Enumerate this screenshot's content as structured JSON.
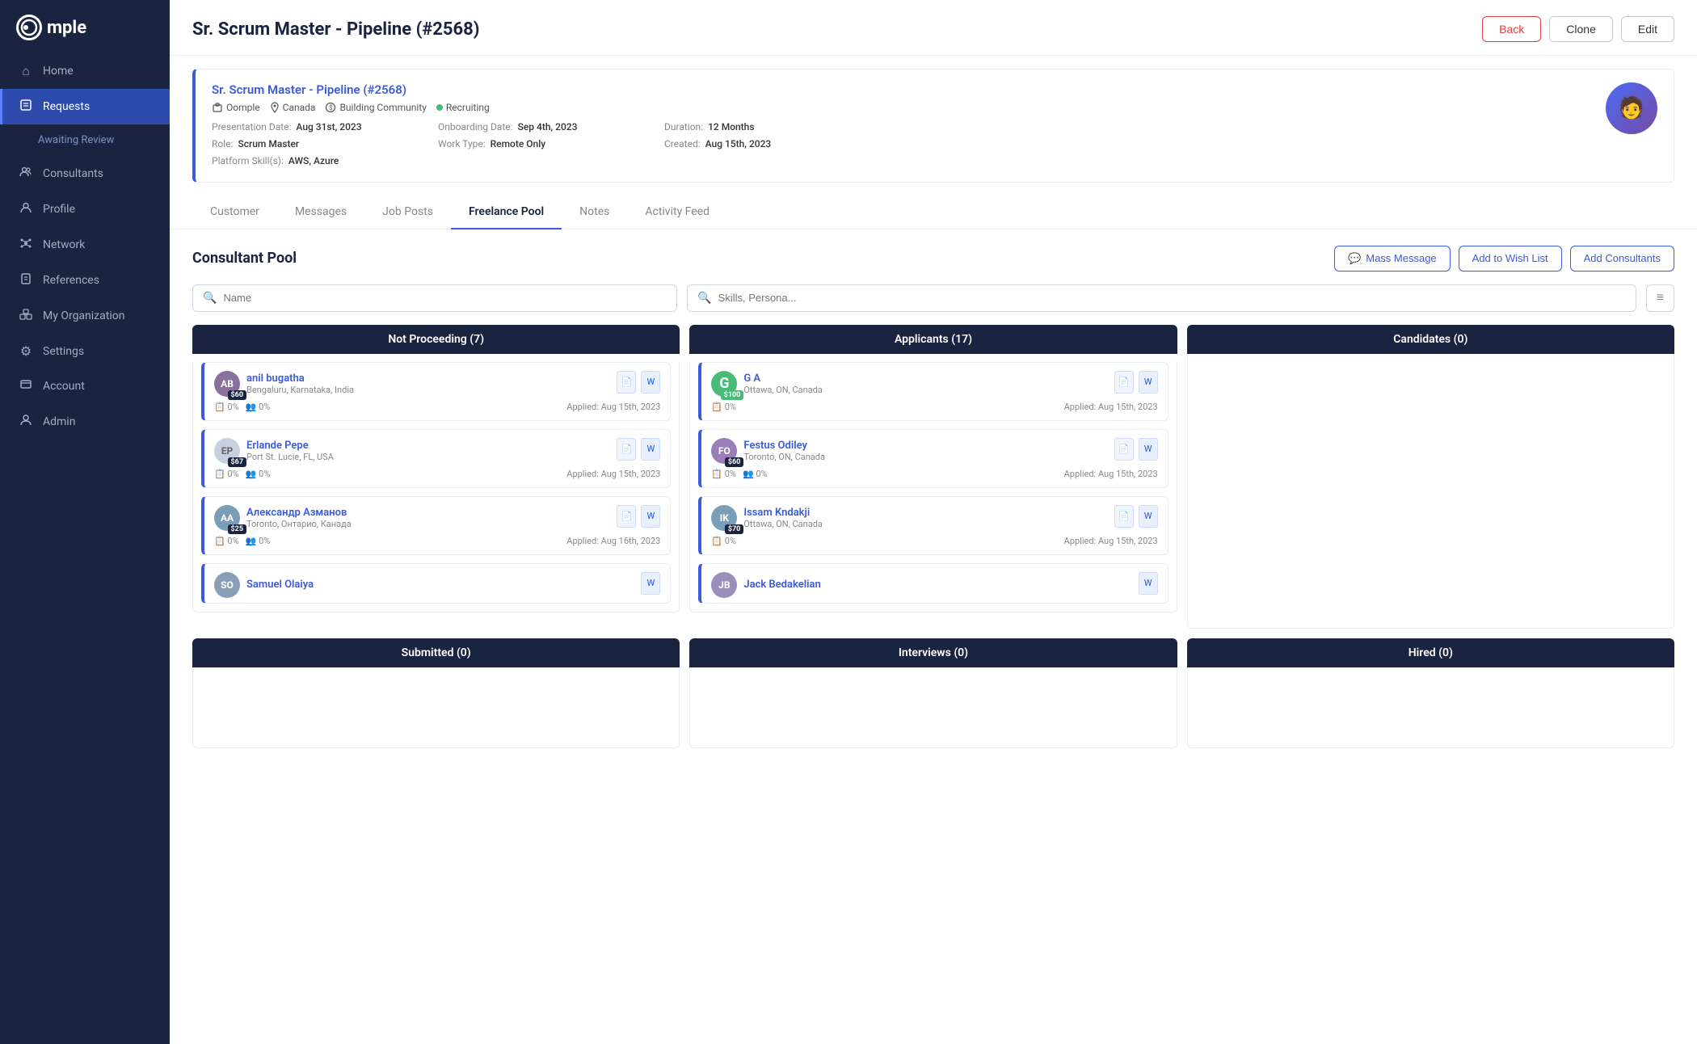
{
  "app": {
    "logo_text": "mple",
    "logo_symbol": "Ω"
  },
  "sidebar": {
    "items": [
      {
        "id": "home",
        "label": "Home",
        "icon": "⌂",
        "active": false
      },
      {
        "id": "requests",
        "label": "Requests",
        "icon": "📋",
        "active": true
      },
      {
        "id": "awaiting-review",
        "label": "Awaiting Review",
        "icon": "",
        "active": false,
        "sub": true
      },
      {
        "id": "consultants",
        "label": "Consultants",
        "icon": "👥",
        "active": false
      },
      {
        "id": "profile",
        "label": "Profile",
        "icon": "👤",
        "active": false
      },
      {
        "id": "network",
        "label": "Network",
        "icon": "🔗",
        "active": false
      },
      {
        "id": "references",
        "label": "References",
        "icon": "📊",
        "active": false
      },
      {
        "id": "my-organization",
        "label": "My Organization",
        "icon": "🏢",
        "active": false
      },
      {
        "id": "settings",
        "label": "Settings",
        "icon": "⚙",
        "active": false
      },
      {
        "id": "account",
        "label": "Account",
        "icon": "🔒",
        "active": false
      },
      {
        "id": "admin",
        "label": "Admin",
        "icon": "👑",
        "active": false
      }
    ]
  },
  "page": {
    "title": "Sr. Scrum Master - Pipeline (#2568)",
    "back_label": "Back",
    "clone_label": "Clone",
    "edit_label": "Edit"
  },
  "info_card": {
    "title": "Sr. Scrum Master - Pipeline (#2568)",
    "company": "Oomple",
    "location": "Canada",
    "budget": "Building Community",
    "status": "Recruiting",
    "presentation_date_label": "Presentation Date:",
    "presentation_date": "Aug 31st, 2023",
    "onboarding_date_label": "Onboarding Date:",
    "onboarding_date": "Sep 4th, 2023",
    "duration_label": "Duration:",
    "duration": "12 Months",
    "role_label": "Role:",
    "role": "Scrum Master",
    "work_type_label": "Work Type:",
    "work_type": "Remote Only",
    "created_label": "Created:",
    "created": "Aug 15th, 2023",
    "skills_label": "Platform Skill(s):",
    "skills": "AWS, Azure"
  },
  "tabs": [
    {
      "label": "Customer",
      "active": false
    },
    {
      "label": "Messages",
      "active": false
    },
    {
      "label": "Job Posts",
      "active": false
    },
    {
      "label": "Freelance Pool",
      "active": true
    },
    {
      "label": "Notes",
      "active": false
    },
    {
      "label": "Activity Feed",
      "active": false
    }
  ],
  "pool": {
    "title": "Consultant Pool",
    "mass_message_label": "Mass Message",
    "add_wish_list_label": "Add to Wish List",
    "add_consultants_label": "Add Consultants",
    "name_placeholder": "Name",
    "skills_placeholder": "Skills, Persona..."
  },
  "columns": {
    "top_row": [
      {
        "id": "not-proceeding",
        "header": "Not Proceeding (7)",
        "consultants": [
          {
            "name": "anil bugatha",
            "location": "Bengaluru, Karnataka, India",
            "price": "$60",
            "price_color": "dark",
            "applied": "Applied: Aug 15th, 2023",
            "match": "0%",
            "team": "0%",
            "avatar_text": "AB",
            "avatar_color": "#8b6f9e"
          },
          {
            "name": "Erlande Pepe",
            "location": "Port St. Lucie, FL, USA",
            "price": "$67",
            "price_color": "dark",
            "applied": "Applied: Aug 15th, 2023",
            "match": "0%",
            "team": "0%",
            "avatar_text": "EP",
            "avatar_color": "#c0c8d8"
          },
          {
            "name": "Александр Азманов",
            "location": "Toronto, Онтарио, Канада",
            "price": "$25",
            "price_color": "dark",
            "applied": "Applied: Aug 16th, 2023",
            "match": "0%",
            "team": "0%",
            "avatar_text": "АА",
            "avatar_color": "#8b6f9e"
          },
          {
            "name": "Samuel Olaiya",
            "location": "",
            "price": "",
            "price_color": "dark",
            "applied": "",
            "match": "",
            "team": "",
            "avatar_text": "SO",
            "avatar_color": "#8b9eb8"
          }
        ]
      },
      {
        "id": "applicants",
        "header": "Applicants (17)",
        "consultants": [
          {
            "name": "G A",
            "location": "Ottawa, ON, Canada",
            "price": "$100",
            "price_color": "green",
            "applied": "Applied: Aug 15th, 2023",
            "match": "0%",
            "team": "",
            "avatar_text": "G",
            "avatar_color": "#48bb78",
            "green_ring": true
          },
          {
            "name": "Festus Odiley",
            "location": "Toronto, ON, Canada",
            "price": "$60",
            "price_color": "dark",
            "applied": "Applied: Aug 15th, 2023",
            "match": "0%",
            "team": "0%",
            "avatar_text": "FO",
            "avatar_color": "#9b7eb8"
          },
          {
            "name": "Issam Kndakji",
            "location": "Ottawa, ON, Canada",
            "price": "$70",
            "price_color": "dark",
            "applied": "Applied: Aug 15th, 2023",
            "match": "0%",
            "team": "",
            "avatar_text": "IK",
            "avatar_color": "#7b9eb8"
          },
          {
            "name": "Jack Bedakelian",
            "location": "",
            "price": "",
            "price_color": "dark",
            "applied": "",
            "match": "",
            "team": "",
            "avatar_text": "JB",
            "avatar_color": "#9b8eb8"
          }
        ]
      },
      {
        "id": "candidates",
        "header": "Candidates (0)",
        "consultants": []
      }
    ],
    "bottom_row": [
      {
        "id": "submitted",
        "header": "Submitted (0)",
        "consultants": []
      },
      {
        "id": "interviews",
        "header": "Interviews (0)",
        "consultants": []
      },
      {
        "id": "hired",
        "header": "Hired (0)",
        "consultants": []
      }
    ]
  }
}
